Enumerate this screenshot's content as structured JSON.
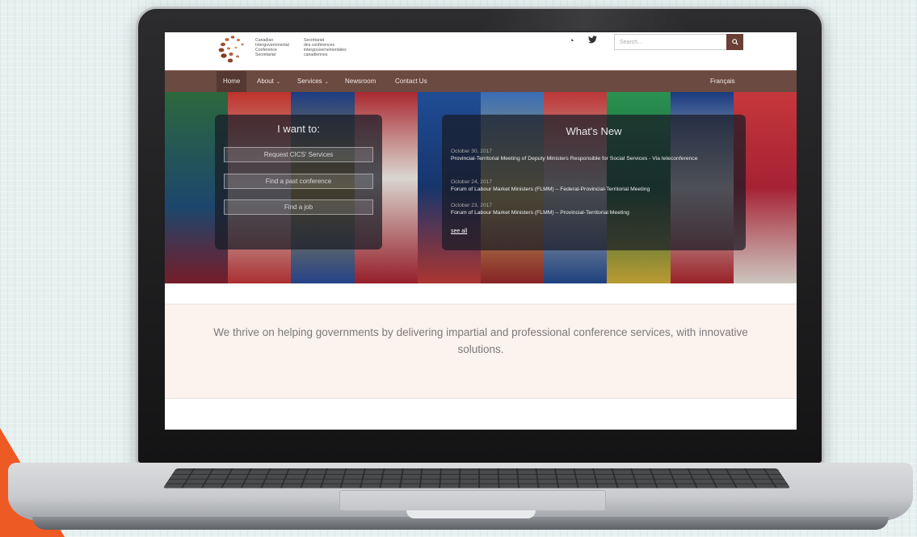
{
  "header": {
    "logo_en": "Canadian\nIntergovernmental\nConference\nSecretariat",
    "logo_fr": "Secrétariat\ndes conférences\nintergouvernementales\ncanadiennes",
    "search_placeholder": "Search..."
  },
  "nav": {
    "items": [
      {
        "label": "Home",
        "active": true
      },
      {
        "label": "About",
        "dropdown": true
      },
      {
        "label": "Services",
        "dropdown": true
      },
      {
        "label": "Newsroom"
      },
      {
        "label": "Contact Us"
      }
    ],
    "language": "Français"
  },
  "want": {
    "title": "I want to:",
    "buttons": [
      "Request CICS' Services",
      "Find a past conference",
      "Find a job"
    ]
  },
  "news": {
    "title": "What's New",
    "items": [
      {
        "date": "October 30, 2017",
        "title": "Provincial-Territorial Meeting of Deputy Ministers Responsible for Social Services - Via teleconference"
      },
      {
        "date": "October 24, 2017",
        "title": "Forum of Labour Market Ministers (FLMM) – Federal-Provincial-Territorial Meeting"
      },
      {
        "date": "October 23, 2017",
        "title": "Forum of Labour Market Ministers (FLMM) – Provincial-Territorial Meeting"
      }
    ],
    "see_all": "see all"
  },
  "tagline": "We thrive on helping governments by delivering impartial and professional conference services, with innovative solutions.",
  "colors": {
    "nav_bg": "#6b4a41",
    "nav_active": "#553831",
    "search_button": "#6b3f35",
    "accent_orange": "#ee5a24",
    "tagline_band": "#fcf2ee"
  },
  "icons": {
    "rss": "rss-icon",
    "twitter": "twitter-icon",
    "search": "search-icon",
    "logo": "cics-logo"
  }
}
